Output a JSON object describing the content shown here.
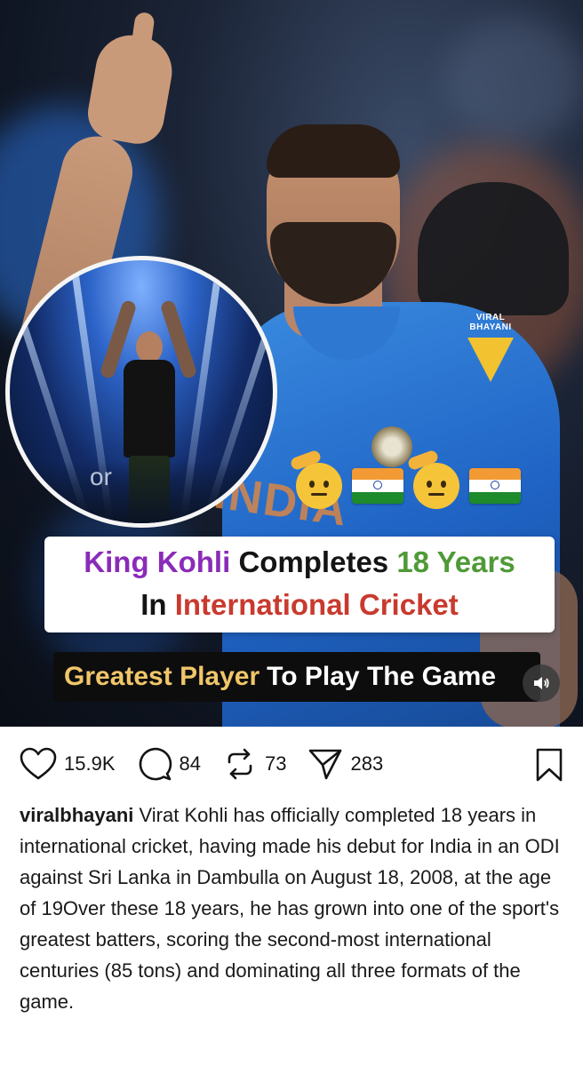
{
  "media": {
    "inset_text": "or",
    "brand_name": "VIRAL BHAYANI",
    "india_print": "INDIA",
    "headline": {
      "line1": [
        {
          "text": "King Kohli",
          "color": "#8a2bb8"
        },
        {
          "text": "Completes",
          "color": "#141414"
        },
        {
          "text": "18 Years",
          "color": "#4f9a37"
        }
      ],
      "line2": [
        {
          "text": "In",
          "color": "#141414"
        },
        {
          "text": "International Cricket",
          "color": "#c93a2e"
        }
      ]
    },
    "tagline": {
      "part1": "Greatest Player",
      "part2": "To Play The Game"
    },
    "emojis": [
      "saluting-face",
      "india-flag",
      "saluting-face",
      "india-flag"
    ]
  },
  "actions": {
    "likes": "15.9K",
    "comments": "84",
    "reposts": "73",
    "shares": "283",
    "icons": [
      "heart-icon",
      "comment-icon",
      "repost-icon",
      "send-icon",
      "bookmark-icon"
    ]
  },
  "caption": {
    "username": "viralbhayani",
    "text": "Virat Kohli has officially completed 18 years in international cricket, having made his debut for India in an ODI against Sri Lanka in Dambulla on August 18, 2008, at the age of 19Over these 18 years, he has grown into one of the sport's greatest batters, scoring the second-most international centuries (85 tons) and dominating all three formats of the game."
  }
}
